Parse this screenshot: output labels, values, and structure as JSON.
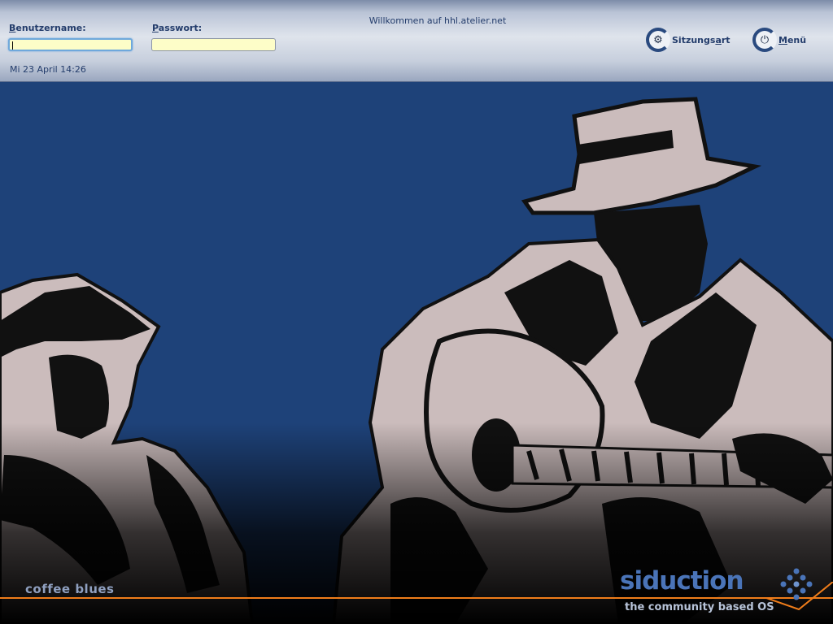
{
  "header": {
    "welcome": "Willkommen auf hhl.atelier.net",
    "datetime": "Mi 23 April 14:26"
  },
  "login": {
    "username_label_first": "B",
    "username_label_rest": "enutzername:",
    "password_label_first": "P",
    "password_label_rest": "asswort:",
    "username_value": "",
    "password_value": ""
  },
  "buttons": {
    "session_label_a": "Sitzungs",
    "session_label_u": "a",
    "session_label_b": "rt",
    "session_icon": "gear-icon",
    "menu_label_u": "M",
    "menu_label_b": "enü",
    "menu_icon": "power-icon"
  },
  "theme": {
    "tagline": "coffee blues",
    "logo": "siduction",
    "logo_sub": "the community based OS"
  },
  "colors": {
    "background": "#1e4279",
    "field_bg": "#fdfdc8",
    "accent_line": "#f07d1a",
    "logo": "#4a74b8",
    "figure_fill": "#cbbcbc"
  }
}
